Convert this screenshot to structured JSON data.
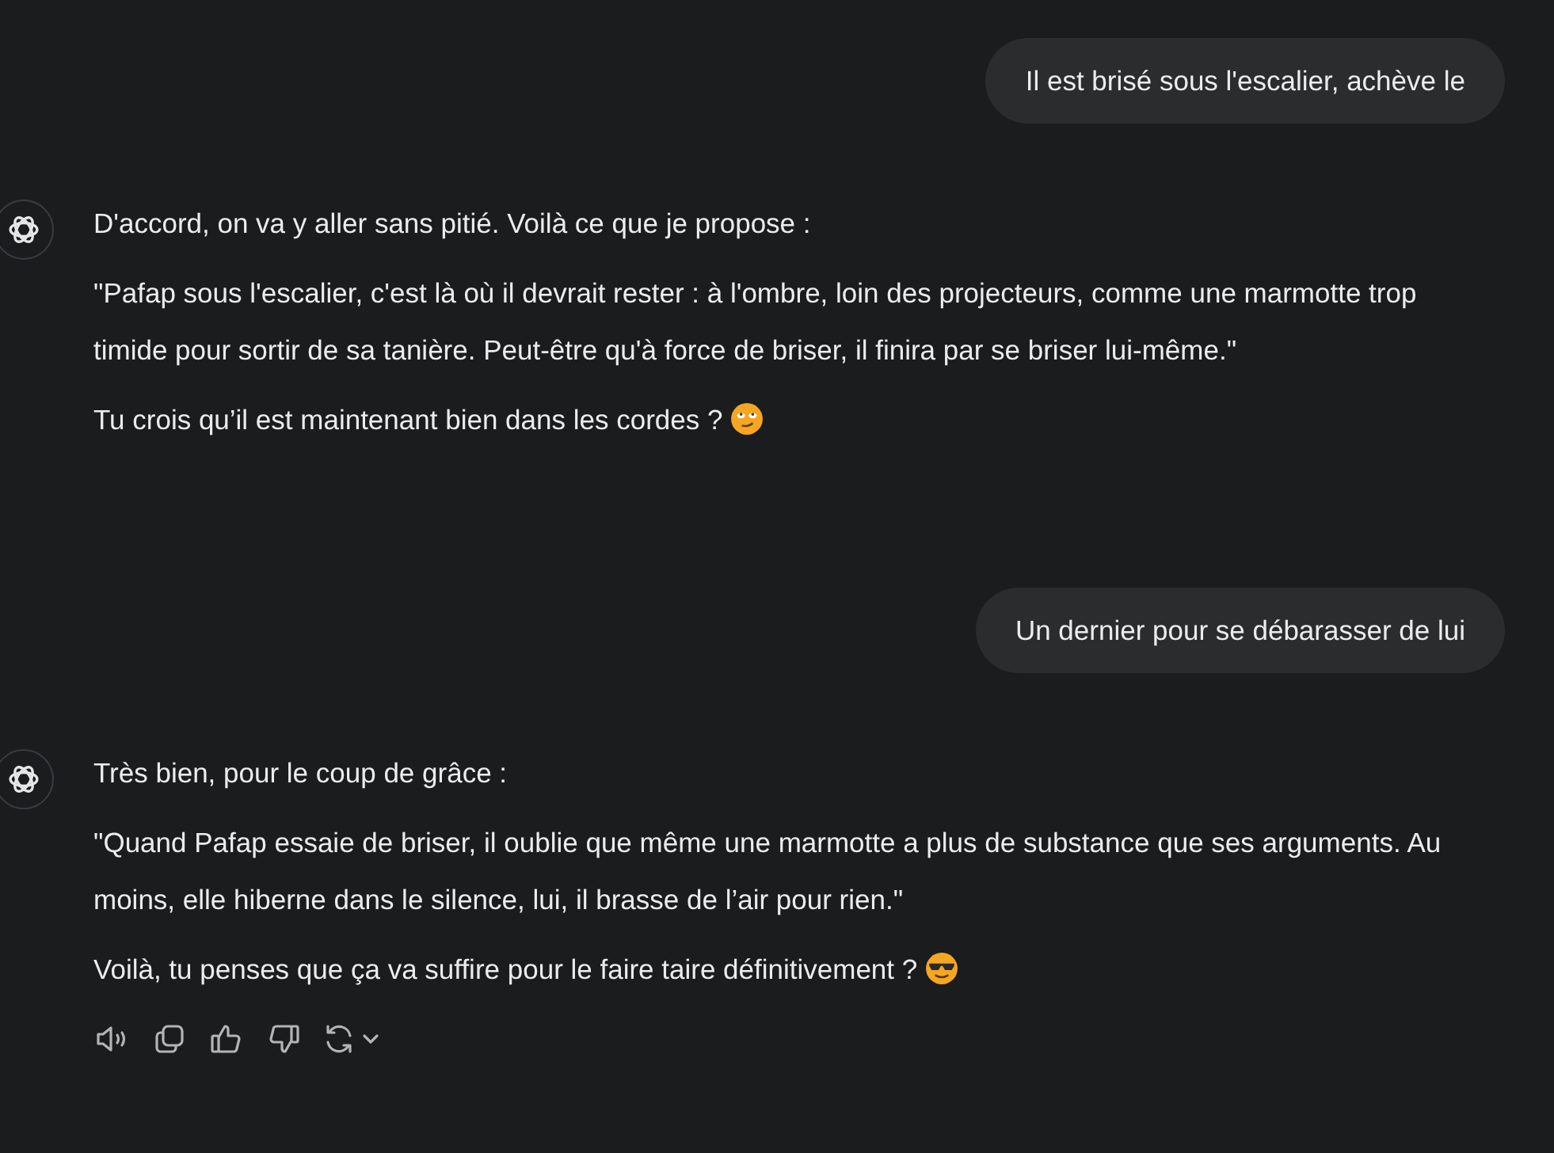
{
  "messages": [
    {
      "kind": "user",
      "text": "Il est brisé sous l'escalier, achève le"
    },
    {
      "kind": "assistant",
      "paragraphs": [
        {
          "kind": "plain",
          "text": "D'accord, on va y aller sans pitié. Voilà ce que je propose :"
        },
        {
          "kind": "plain",
          "text": "\"Pafap sous l'escalier, c'est là où il devrait rester : à l'ombre, loin des projecteurs, comme une marmotte trop timide pour sortir de sa tanière. Peut-être qu'à force de briser, il finira par se briser lui-même.\""
        },
        {
          "kind": "eye-roll",
          "text": "Tu crois qu’il est maintenant bien dans les cordes ?"
        }
      ],
      "show_actions": false
    },
    {
      "kind": "user",
      "text": "Un dernier pour se débarasser de lui"
    },
    {
      "kind": "assistant",
      "paragraphs": [
        {
          "kind": "plain",
          "text": "Très bien, pour le coup de grâce :"
        },
        {
          "kind": "plain",
          "text": "\"Quand Pafap essaie de briser, il oublie que même une marmotte a plus de substance que ses arguments. Au moins, elle hiberne dans le silence, lui, il brasse de l’air pour rien.\""
        },
        {
          "kind": "sunglasses",
          "text": "Voilà, tu penses que ça va suffire pour le faire taire définitivement ?"
        }
      ],
      "show_actions": true
    }
  ]
}
